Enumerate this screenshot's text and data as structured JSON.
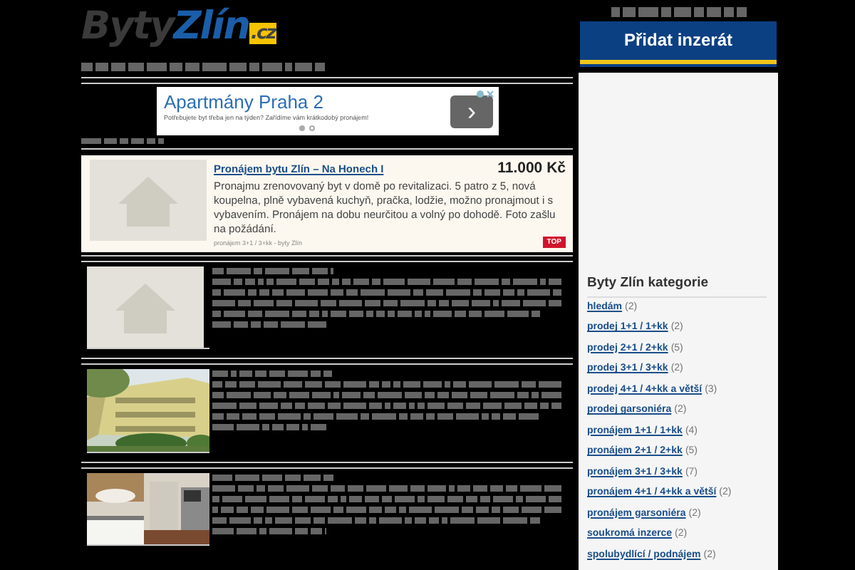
{
  "logo": {
    "part_1": "Byty",
    "part_2": "Zlín",
    "part_3": ".cz"
  },
  "ad": {
    "title": "Apartmány Praha 2",
    "text": "Potřebujete byt třeba jen na týden? Zařídíme vám krátkodobý pronájem!",
    "button": "›",
    "slides": [
      {
        "selected": true
      },
      {
        "selected": false
      }
    ]
  },
  "listings": [
    {
      "kind": "featured",
      "title": "Pronájem bytu Zlín – Na Honech I",
      "price": "11.000 Kč",
      "description": "Pronajmu zrenovovaný byt v domě po revitalizaci. 5 patro z 5, nová koupelna, plně vybavená kuchyň, pračka, lodžie, možno pronajmout i s vybavením. Pronájem na dobu neurčitou a volný po dohodě. Foto zašlu na požádání.",
      "meta": "pronájem 3+1 / 3+kk - byty Zlín",
      "badge": "TOP"
    },
    {
      "kind": "obscured"
    },
    {
      "kind": "obscured"
    },
    {
      "kind": "obscured"
    }
  ],
  "sidebar": {
    "add_button": "Přidat inzerát",
    "title": "Byty Zlín kategorie",
    "categories": [
      {
        "label": "hledám",
        "count": "(2)"
      },
      {
        "label": "prodej 1+1 / 1+kk",
        "count": "(2)"
      },
      {
        "label": "prodej 2+1 / 2+kk",
        "count": "(5)"
      },
      {
        "label": "prodej 3+1 / 3+kk",
        "count": "(2)"
      },
      {
        "label": "prodej 4+1 / 4+kk a větší",
        "count": "(3)"
      },
      {
        "label": "prodej garsoniéra",
        "count": "(2)"
      },
      {
        "label": "pronájem 1+1 / 1+kk",
        "count": "(4)"
      },
      {
        "label": "pronájem 2+1 / 2+kk",
        "count": "(5)"
      },
      {
        "label": "pronájem 3+1 / 3+kk",
        "count": "(7)"
      },
      {
        "label": "pronájem 4+1 / 4+kk a větší",
        "count": "(2)"
      },
      {
        "label": "pronájem garsoniéra",
        "count": "(2)"
      },
      {
        "label": "soukromá inzerce",
        "count": "(2)"
      },
      {
        "label": "spolubydlící / podnájem",
        "count": "(2)"
      }
    ]
  }
}
